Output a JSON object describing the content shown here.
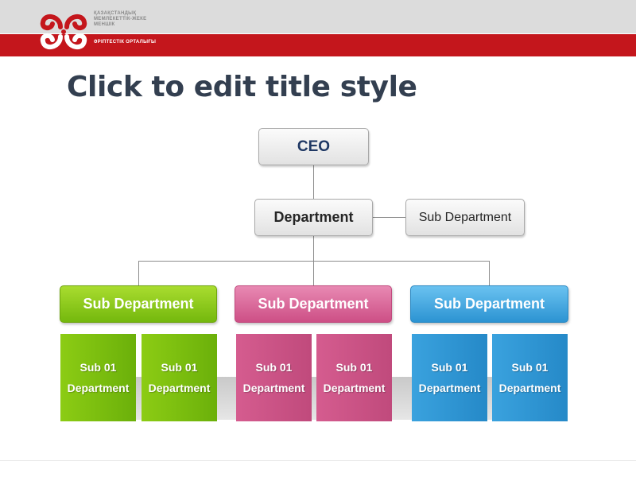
{
  "header": {
    "org_line_1": "ҚАЗАҚСТАНДЫҚ МЕМЛЕКЕТТІК-ЖЕКЕ МЕНШІК",
    "org_line_2": "ӘРІПТЕСТІК ОРТАЛЫҒЫ"
  },
  "slide": {
    "title": "Click to edit title style"
  },
  "org_chart": {
    "ceo": "CEO",
    "department": "Department",
    "side_sub_department": "Sub Department",
    "sub_departments": [
      {
        "label": "Sub Department",
        "color": "#8cc91d",
        "children": [
          {
            "line1": "Sub 01",
            "line2": "Department"
          },
          {
            "line1": "Sub 01",
            "line2": "Department"
          }
        ]
      },
      {
        "label": "Sub Department",
        "color": "#d6639a",
        "children": [
          {
            "line1": "Sub 01",
            "line2": "Department"
          },
          {
            "line1": "Sub 01",
            "line2": "Department"
          }
        ]
      },
      {
        "label": "Sub Department",
        "color": "#3aa4e1",
        "children": [
          {
            "line1": "Sub 01",
            "line2": "Department"
          },
          {
            "line1": "Sub 01",
            "line2": "Department"
          }
        ]
      }
    ]
  },
  "colors": {
    "header_red": "#c4161c",
    "header_gray": "#dcdcdc",
    "title": "#333f50"
  }
}
